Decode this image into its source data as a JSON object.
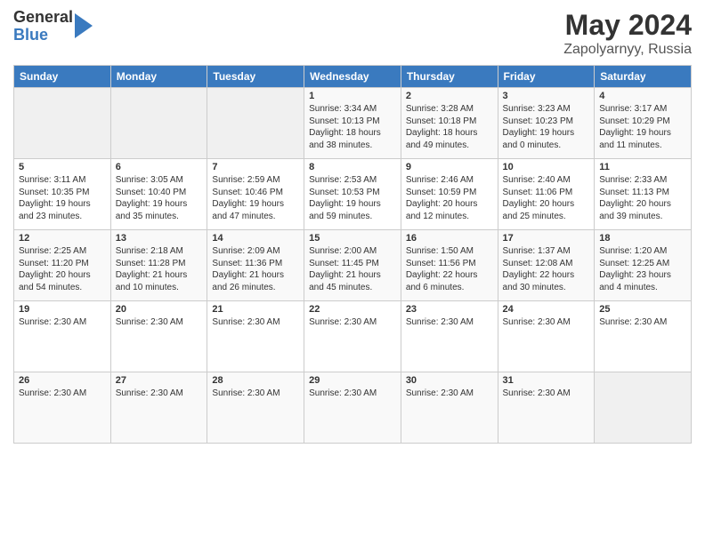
{
  "logo": {
    "general": "General",
    "blue": "Blue"
  },
  "title": "May 2024",
  "subtitle": "Zapolyarnyy, Russia",
  "days_header": [
    "Sunday",
    "Monday",
    "Tuesday",
    "Wednesday",
    "Thursday",
    "Friday",
    "Saturday"
  ],
  "weeks": [
    [
      {
        "num": "",
        "info": ""
      },
      {
        "num": "",
        "info": ""
      },
      {
        "num": "",
        "info": ""
      },
      {
        "num": "1",
        "info": "Sunrise: 3:34 AM\nSunset: 10:13 PM\nDaylight: 18 hours\nand 38 minutes."
      },
      {
        "num": "2",
        "info": "Sunrise: 3:28 AM\nSunset: 10:18 PM\nDaylight: 18 hours\nand 49 minutes."
      },
      {
        "num": "3",
        "info": "Sunrise: 3:23 AM\nSunset: 10:23 PM\nDaylight: 19 hours\nand 0 minutes."
      },
      {
        "num": "4",
        "info": "Sunrise: 3:17 AM\nSunset: 10:29 PM\nDaylight: 19 hours\nand 11 minutes."
      }
    ],
    [
      {
        "num": "5",
        "info": "Sunrise: 3:11 AM\nSunset: 10:35 PM\nDaylight: 19 hours\nand 23 minutes."
      },
      {
        "num": "6",
        "info": "Sunrise: 3:05 AM\nSunset: 10:40 PM\nDaylight: 19 hours\nand 35 minutes."
      },
      {
        "num": "7",
        "info": "Sunrise: 2:59 AM\nSunset: 10:46 PM\nDaylight: 19 hours\nand 47 minutes."
      },
      {
        "num": "8",
        "info": "Sunrise: 2:53 AM\nSunset: 10:53 PM\nDaylight: 19 hours\nand 59 minutes."
      },
      {
        "num": "9",
        "info": "Sunrise: 2:46 AM\nSunset: 10:59 PM\nDaylight: 20 hours\nand 12 minutes."
      },
      {
        "num": "10",
        "info": "Sunrise: 2:40 AM\nSunset: 11:06 PM\nDaylight: 20 hours\nand 25 minutes."
      },
      {
        "num": "11",
        "info": "Sunrise: 2:33 AM\nSunset: 11:13 PM\nDaylight: 20 hours\nand 39 minutes."
      }
    ],
    [
      {
        "num": "12",
        "info": "Sunrise: 2:25 AM\nSunset: 11:20 PM\nDaylight: 20 hours\nand 54 minutes."
      },
      {
        "num": "13",
        "info": "Sunrise: 2:18 AM\nSunset: 11:28 PM\nDaylight: 21 hours\nand 10 minutes."
      },
      {
        "num": "14",
        "info": "Sunrise: 2:09 AM\nSunset: 11:36 PM\nDaylight: 21 hours\nand 26 minutes."
      },
      {
        "num": "15",
        "info": "Sunrise: 2:00 AM\nSunset: 11:45 PM\nDaylight: 21 hours\nand 45 minutes."
      },
      {
        "num": "16",
        "info": "Sunrise: 1:50 AM\nSunset: 11:56 PM\nDaylight: 22 hours\nand 6 minutes."
      },
      {
        "num": "17",
        "info": "Sunrise: 1:37 AM\nSunset: 12:08 AM\nDaylight: 22 hours\nand 30 minutes."
      },
      {
        "num": "18",
        "info": "Sunrise: 1:20 AM\nSunset: 12:25 AM\nDaylight: 23 hours\nand 4 minutes."
      }
    ],
    [
      {
        "num": "19",
        "info": "Sunrise: 2:30 AM"
      },
      {
        "num": "20",
        "info": "Sunrise: 2:30 AM"
      },
      {
        "num": "21",
        "info": "Sunrise: 2:30 AM"
      },
      {
        "num": "22",
        "info": "Sunrise: 2:30 AM"
      },
      {
        "num": "23",
        "info": "Sunrise: 2:30 AM"
      },
      {
        "num": "24",
        "info": "Sunrise: 2:30 AM"
      },
      {
        "num": "25",
        "info": "Sunrise: 2:30 AM"
      }
    ],
    [
      {
        "num": "26",
        "info": "Sunrise: 2:30 AM"
      },
      {
        "num": "27",
        "info": "Sunrise: 2:30 AM"
      },
      {
        "num": "28",
        "info": "Sunrise: 2:30 AM"
      },
      {
        "num": "29",
        "info": "Sunrise: 2:30 AM"
      },
      {
        "num": "30",
        "info": "Sunrise: 2:30 AM"
      },
      {
        "num": "31",
        "info": "Sunrise: 2:30 AM"
      },
      {
        "num": "",
        "info": ""
      }
    ]
  ]
}
